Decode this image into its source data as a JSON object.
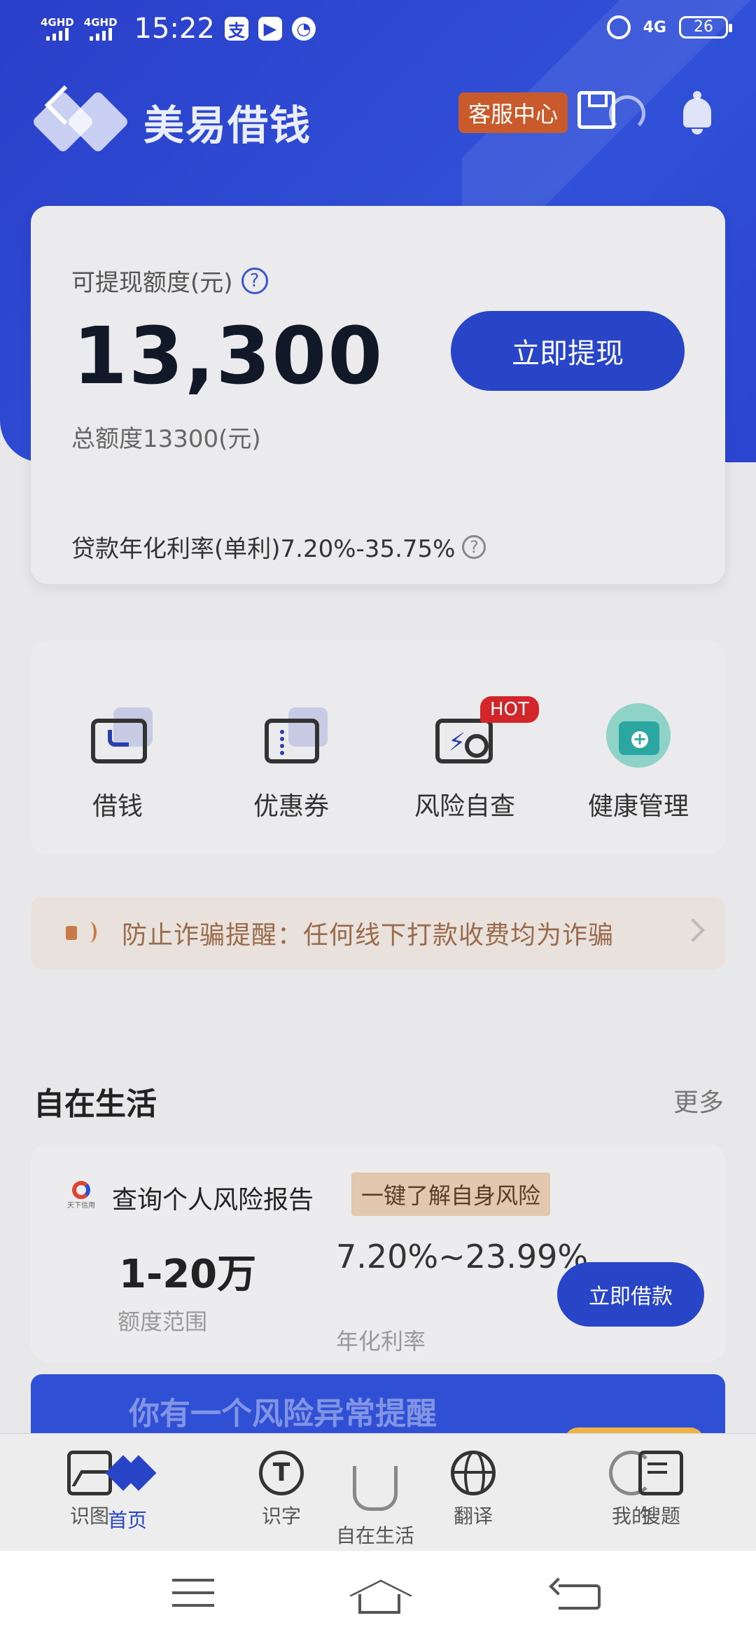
{
  "status_bar": {
    "signal1": "4GHD",
    "signal2": "4GHD",
    "time": "15:22",
    "app_icon1": "支",
    "network": "4G",
    "battery": "26"
  },
  "header": {
    "brand": "美易借钱",
    "service_label": "客服中心"
  },
  "credit": {
    "label": "可提现额度(元)",
    "help": "?",
    "amount": "13,300",
    "withdraw_label": "立即提现",
    "total": "总额度13300(元)",
    "rate": "贷款年化利率(单利)7.20%-35.75%",
    "rate_help": "?"
  },
  "quick_actions": [
    {
      "label": "借钱"
    },
    {
      "label": "优惠券"
    },
    {
      "label": "风险自查",
      "badge": "HOT"
    },
    {
      "label": "健康管理"
    }
  ],
  "notice": {
    "text": "防止诈骗提醒：任何线下打款收费均为诈骗"
  },
  "section": {
    "title": "自在生活",
    "more": "更多"
  },
  "product": {
    "logo_text": "天下信用",
    "title": "查询个人风险报告",
    "tag": "一键了解自身风险",
    "range": "1-20万",
    "range_label": "额度范围",
    "rate": "7.20%~23.99%",
    "rate_label": "年化利率",
    "button": "立即借款"
  },
  "alert": {
    "text": "你有一个风险异常提醒"
  },
  "tabs": [
    {
      "label": "识图"
    },
    {
      "label": "首页"
    },
    {
      "label": "识字"
    },
    {
      "label": "自在生活"
    },
    {
      "label": "翻译"
    },
    {
      "label": "我的"
    },
    {
      "label": "搜题"
    }
  ],
  "colors": {
    "brand_blue": "#2945c7",
    "hot_red": "#d3262b",
    "service_orange": "#c85a2b"
  }
}
